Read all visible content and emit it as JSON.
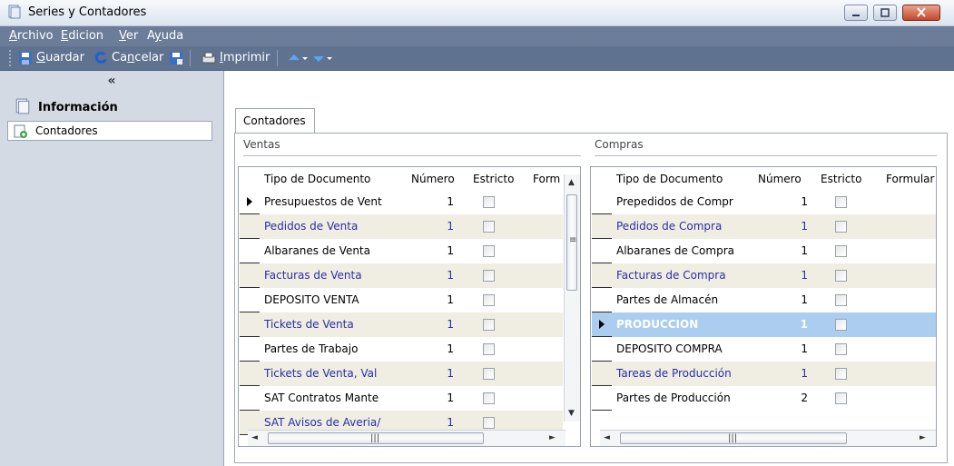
{
  "window": {
    "title": "Series y Contadores"
  },
  "menu": [
    {
      "pre": "",
      "key": "A",
      "post": "rchivo"
    },
    {
      "pre": "",
      "key": "E",
      "post": "dicion"
    },
    {
      "pre": "",
      "key": "V",
      "post": "er"
    },
    {
      "pre": "A",
      "key": "y",
      "post": "uda"
    }
  ],
  "toolbar": {
    "guardar_pre": "",
    "guardar_key": "G",
    "guardar_post": "uardar",
    "cancelar_pre": "Ca",
    "cancelar_key": "n",
    "cancelar_post": "celar",
    "imprimir_pre": "",
    "imprimir_key": "I",
    "imprimir_post": "mprimir"
  },
  "sidebar": {
    "collapse": "«",
    "section": "Información",
    "items": [
      "Contadores"
    ]
  },
  "tab": {
    "label": "Contadores"
  },
  "ventas": {
    "label": "Ventas",
    "columns": [
      "Tipo de Documento",
      "Número",
      "Estricto",
      "Form"
    ],
    "rows": [
      {
        "tipo": "Presupuestos de Vent",
        "numero": "1"
      },
      {
        "tipo": "Pedidos de Venta",
        "numero": "1"
      },
      {
        "tipo": "Albaranes de Venta",
        "numero": "1"
      },
      {
        "tipo": "Facturas de Venta",
        "numero": "1"
      },
      {
        "tipo": "DEPOSITO VENTA",
        "numero": "1"
      },
      {
        "tipo": "Tickets de Venta",
        "numero": "1"
      },
      {
        "tipo": "Partes de Trabajo",
        "numero": "1"
      },
      {
        "tipo": "Tickets de Venta, Val",
        "numero": "1"
      },
      {
        "tipo": "SAT Contratos Mante",
        "numero": "1"
      },
      {
        "tipo": "SAT Avisos de Averia/",
        "numero": "1"
      }
    ]
  },
  "compras": {
    "label": "Compras",
    "columns": [
      "Tipo de Documento",
      "Número",
      "Estricto",
      "Formular"
    ],
    "rows": [
      {
        "tipo": "Prepedidos de Compr",
        "numero": "1"
      },
      {
        "tipo": "Pedidos de Compra",
        "numero": "1"
      },
      {
        "tipo": "Albaranes de Compra",
        "numero": "1"
      },
      {
        "tipo": "Facturas de Compra",
        "numero": "1"
      },
      {
        "tipo": "Partes de Almacén",
        "numero": "1"
      },
      {
        "tipo": "PRODUCCION",
        "numero": "1"
      },
      {
        "tipo": "DEPOSITO COMPRA",
        "numero": "1"
      },
      {
        "tipo": "Tareas de Producción",
        "numero": "1"
      },
      {
        "tipo": "Partes de Producción",
        "numero": "2"
      }
    ]
  },
  "colors": {
    "menubar": "#6b7d98",
    "toolbar": "#5f7290",
    "sidebar": "#d4dae4",
    "alt_row": "#f0ede2",
    "selected_row": "#aacdf0",
    "alt_text": "#2a2ea8"
  }
}
